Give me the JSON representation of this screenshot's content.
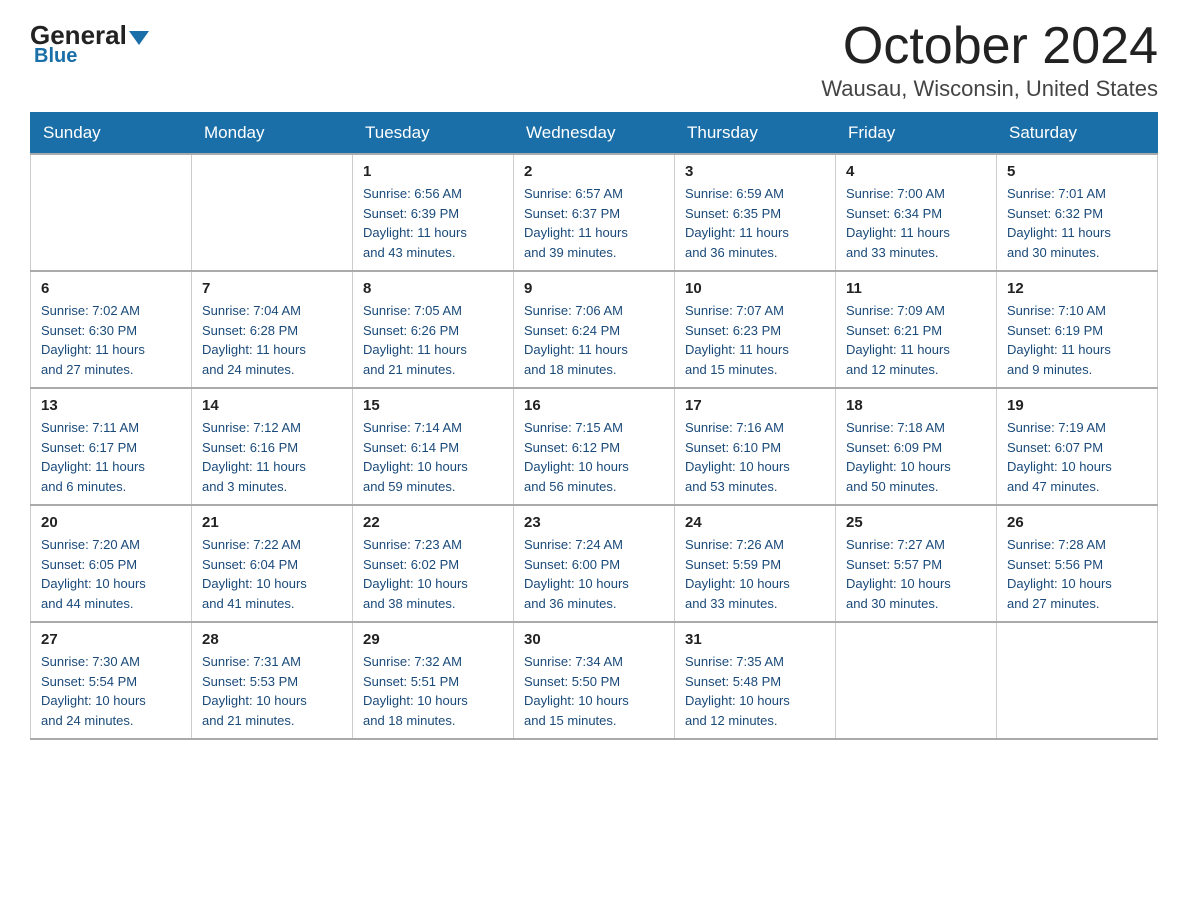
{
  "header": {
    "logo_general": "General",
    "logo_blue": "Blue",
    "month_title": "October 2024",
    "location": "Wausau, Wisconsin, United States"
  },
  "days_of_week": [
    "Sunday",
    "Monday",
    "Tuesday",
    "Wednesday",
    "Thursday",
    "Friday",
    "Saturday"
  ],
  "weeks": [
    [
      {
        "day": "",
        "info": ""
      },
      {
        "day": "",
        "info": ""
      },
      {
        "day": "1",
        "info": "Sunrise: 6:56 AM\nSunset: 6:39 PM\nDaylight: 11 hours\nand 43 minutes."
      },
      {
        "day": "2",
        "info": "Sunrise: 6:57 AM\nSunset: 6:37 PM\nDaylight: 11 hours\nand 39 minutes."
      },
      {
        "day": "3",
        "info": "Sunrise: 6:59 AM\nSunset: 6:35 PM\nDaylight: 11 hours\nand 36 minutes."
      },
      {
        "day": "4",
        "info": "Sunrise: 7:00 AM\nSunset: 6:34 PM\nDaylight: 11 hours\nand 33 minutes."
      },
      {
        "day": "5",
        "info": "Sunrise: 7:01 AM\nSunset: 6:32 PM\nDaylight: 11 hours\nand 30 minutes."
      }
    ],
    [
      {
        "day": "6",
        "info": "Sunrise: 7:02 AM\nSunset: 6:30 PM\nDaylight: 11 hours\nand 27 minutes."
      },
      {
        "day": "7",
        "info": "Sunrise: 7:04 AM\nSunset: 6:28 PM\nDaylight: 11 hours\nand 24 minutes."
      },
      {
        "day": "8",
        "info": "Sunrise: 7:05 AM\nSunset: 6:26 PM\nDaylight: 11 hours\nand 21 minutes."
      },
      {
        "day": "9",
        "info": "Sunrise: 7:06 AM\nSunset: 6:24 PM\nDaylight: 11 hours\nand 18 minutes."
      },
      {
        "day": "10",
        "info": "Sunrise: 7:07 AM\nSunset: 6:23 PM\nDaylight: 11 hours\nand 15 minutes."
      },
      {
        "day": "11",
        "info": "Sunrise: 7:09 AM\nSunset: 6:21 PM\nDaylight: 11 hours\nand 12 minutes."
      },
      {
        "day": "12",
        "info": "Sunrise: 7:10 AM\nSunset: 6:19 PM\nDaylight: 11 hours\nand 9 minutes."
      }
    ],
    [
      {
        "day": "13",
        "info": "Sunrise: 7:11 AM\nSunset: 6:17 PM\nDaylight: 11 hours\nand 6 minutes."
      },
      {
        "day": "14",
        "info": "Sunrise: 7:12 AM\nSunset: 6:16 PM\nDaylight: 11 hours\nand 3 minutes."
      },
      {
        "day": "15",
        "info": "Sunrise: 7:14 AM\nSunset: 6:14 PM\nDaylight: 10 hours\nand 59 minutes."
      },
      {
        "day": "16",
        "info": "Sunrise: 7:15 AM\nSunset: 6:12 PM\nDaylight: 10 hours\nand 56 minutes."
      },
      {
        "day": "17",
        "info": "Sunrise: 7:16 AM\nSunset: 6:10 PM\nDaylight: 10 hours\nand 53 minutes."
      },
      {
        "day": "18",
        "info": "Sunrise: 7:18 AM\nSunset: 6:09 PM\nDaylight: 10 hours\nand 50 minutes."
      },
      {
        "day": "19",
        "info": "Sunrise: 7:19 AM\nSunset: 6:07 PM\nDaylight: 10 hours\nand 47 minutes."
      }
    ],
    [
      {
        "day": "20",
        "info": "Sunrise: 7:20 AM\nSunset: 6:05 PM\nDaylight: 10 hours\nand 44 minutes."
      },
      {
        "day": "21",
        "info": "Sunrise: 7:22 AM\nSunset: 6:04 PM\nDaylight: 10 hours\nand 41 minutes."
      },
      {
        "day": "22",
        "info": "Sunrise: 7:23 AM\nSunset: 6:02 PM\nDaylight: 10 hours\nand 38 minutes."
      },
      {
        "day": "23",
        "info": "Sunrise: 7:24 AM\nSunset: 6:00 PM\nDaylight: 10 hours\nand 36 minutes."
      },
      {
        "day": "24",
        "info": "Sunrise: 7:26 AM\nSunset: 5:59 PM\nDaylight: 10 hours\nand 33 minutes."
      },
      {
        "day": "25",
        "info": "Sunrise: 7:27 AM\nSunset: 5:57 PM\nDaylight: 10 hours\nand 30 minutes."
      },
      {
        "day": "26",
        "info": "Sunrise: 7:28 AM\nSunset: 5:56 PM\nDaylight: 10 hours\nand 27 minutes."
      }
    ],
    [
      {
        "day": "27",
        "info": "Sunrise: 7:30 AM\nSunset: 5:54 PM\nDaylight: 10 hours\nand 24 minutes."
      },
      {
        "day": "28",
        "info": "Sunrise: 7:31 AM\nSunset: 5:53 PM\nDaylight: 10 hours\nand 21 minutes."
      },
      {
        "day": "29",
        "info": "Sunrise: 7:32 AM\nSunset: 5:51 PM\nDaylight: 10 hours\nand 18 minutes."
      },
      {
        "day": "30",
        "info": "Sunrise: 7:34 AM\nSunset: 5:50 PM\nDaylight: 10 hours\nand 15 minutes."
      },
      {
        "day": "31",
        "info": "Sunrise: 7:35 AM\nSunset: 5:48 PM\nDaylight: 10 hours\nand 12 minutes."
      },
      {
        "day": "",
        "info": ""
      },
      {
        "day": "",
        "info": ""
      }
    ]
  ]
}
